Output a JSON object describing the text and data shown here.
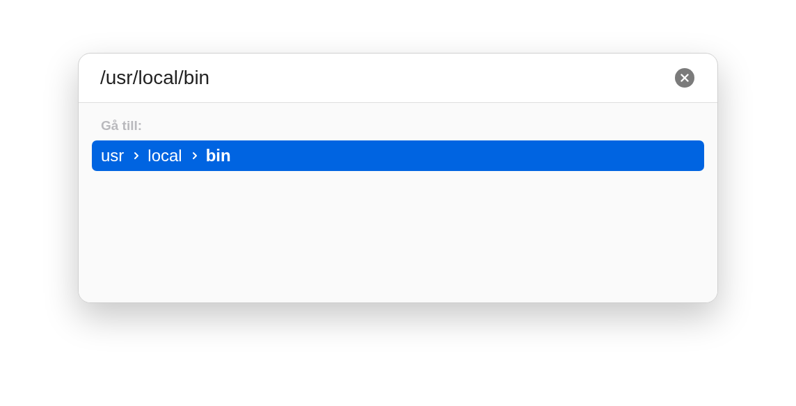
{
  "search": {
    "value": "/usr/local/bin"
  },
  "results": {
    "heading": "Gå till:",
    "items": [
      {
        "selected": true,
        "segments": [
          {
            "text": "usr",
            "bold": false
          },
          {
            "text": "local",
            "bold": false
          },
          {
            "text": "bin",
            "bold": true
          }
        ]
      }
    ]
  }
}
